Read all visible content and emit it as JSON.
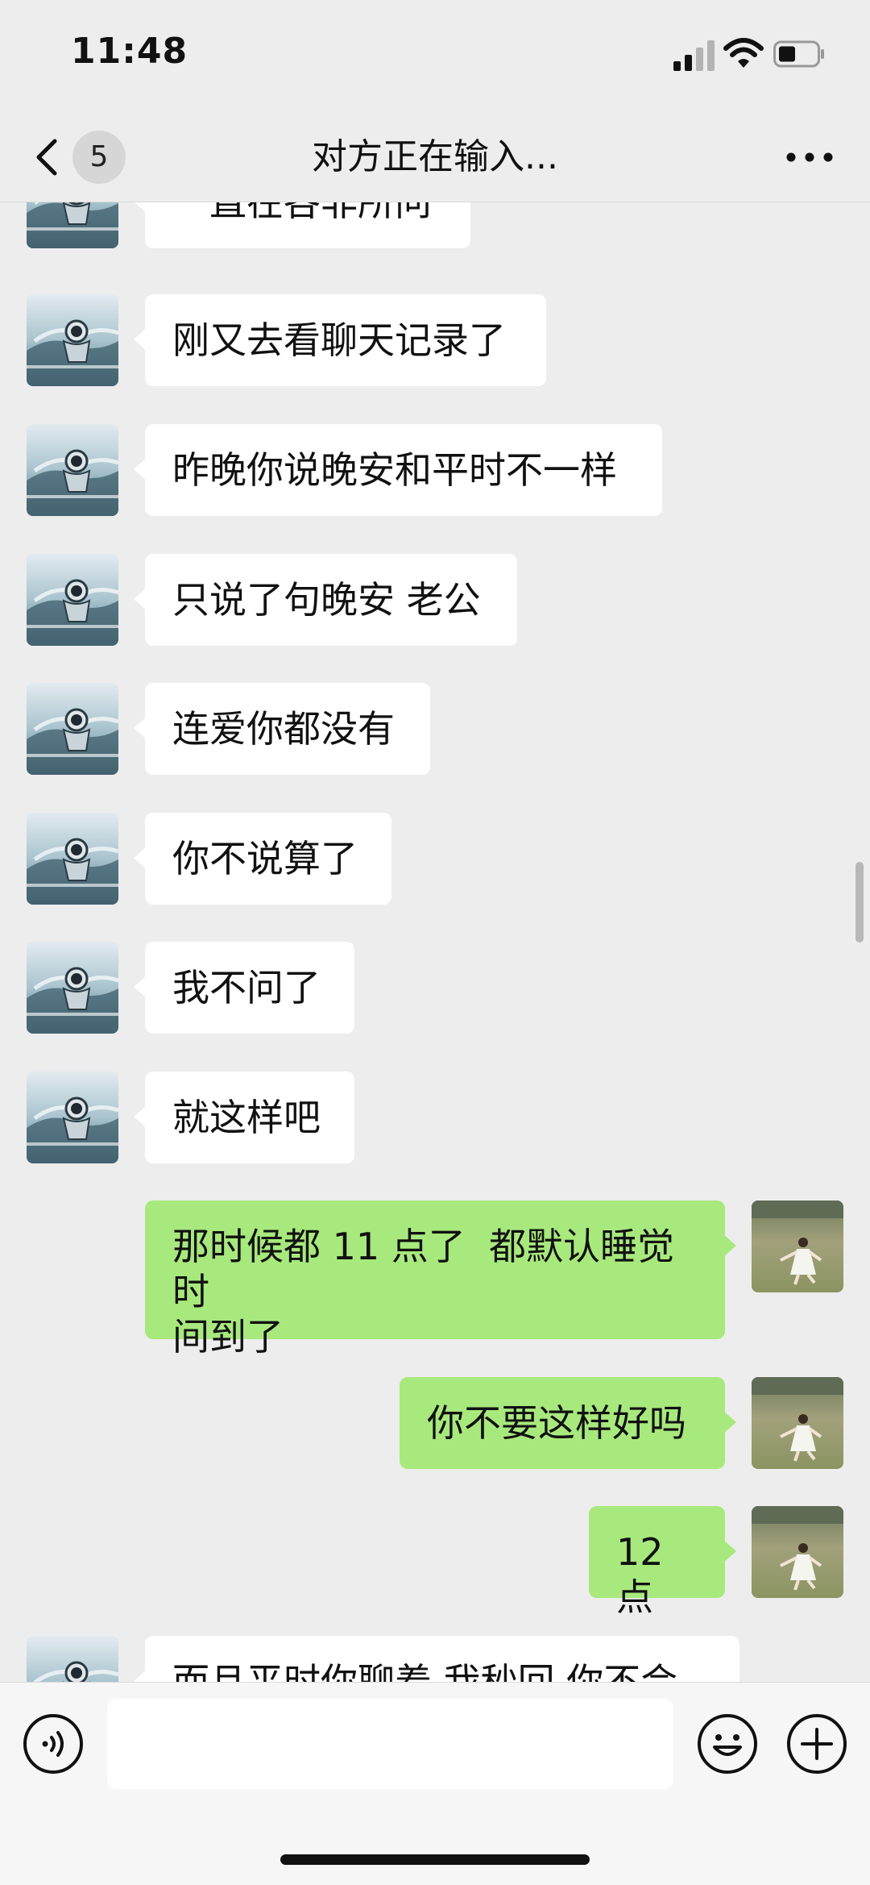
{
  "status": {
    "time": "11:48"
  },
  "nav": {
    "unread_count": "5",
    "title": "对方正在输入..."
  },
  "messages": [
    {
      "side": "in",
      "text": "一直在各非所问"
    },
    {
      "side": "in",
      "text": "刚又去看聊天记录了"
    },
    {
      "side": "in",
      "text": "昨晚你说晚安和平时不一样"
    },
    {
      "side": "in",
      "text": "只说了句晚安 老公"
    },
    {
      "side": "in",
      "text": "连爱你都没有"
    },
    {
      "side": "in",
      "text": "你不说算了"
    },
    {
      "side": "in",
      "text": "我不问了"
    },
    {
      "side": "in",
      "text": "就这样吧"
    },
    {
      "side": "out",
      "text": "那时候都 11 点了  都默认睡觉时\n间到了"
    },
    {
      "side": "out",
      "text": "你不要这样好吗"
    },
    {
      "side": "out",
      "text": "12 点"
    },
    {
      "side": "in",
      "text": "而且平时你聊着 我秒回 你不会"
    }
  ],
  "input": {
    "value": ""
  },
  "colors": {
    "background": "#ededed",
    "incoming_bubble": "#ffffff",
    "outgoing_bubble": "#a8e97d"
  },
  "icons": {
    "back": "chevron-left-icon",
    "more": "more-dots-icon",
    "voice": "voice-icon",
    "emoji": "emoji-icon",
    "plus": "plus-icon",
    "contact_avatar": "astronaut-avatar",
    "self_avatar": "girl-in-field-avatar"
  }
}
